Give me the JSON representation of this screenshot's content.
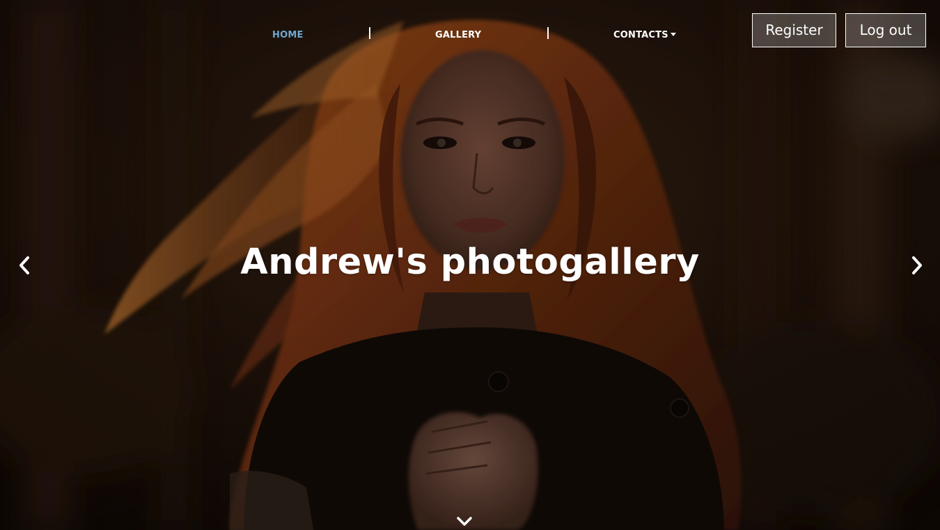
{
  "nav": {
    "items": [
      {
        "label": "HOME",
        "active": true
      },
      {
        "label": "GALLERY",
        "active": false
      },
      {
        "label": "CONTACTS",
        "active": false
      }
    ],
    "separator": "|",
    "active_color": "#6ea9d2"
  },
  "auth": {
    "register_label": "Register",
    "logout_label": "Log out"
  },
  "hero": {
    "title": "Andrew's photogallery",
    "background": "portrait-photo-red-hair-woman-forest"
  },
  "icons": {
    "prev": "chevron-left-icon",
    "next": "chevron-right-icon",
    "scroll": "chevron-down-icon",
    "dropdown": "caret-down-icon"
  }
}
